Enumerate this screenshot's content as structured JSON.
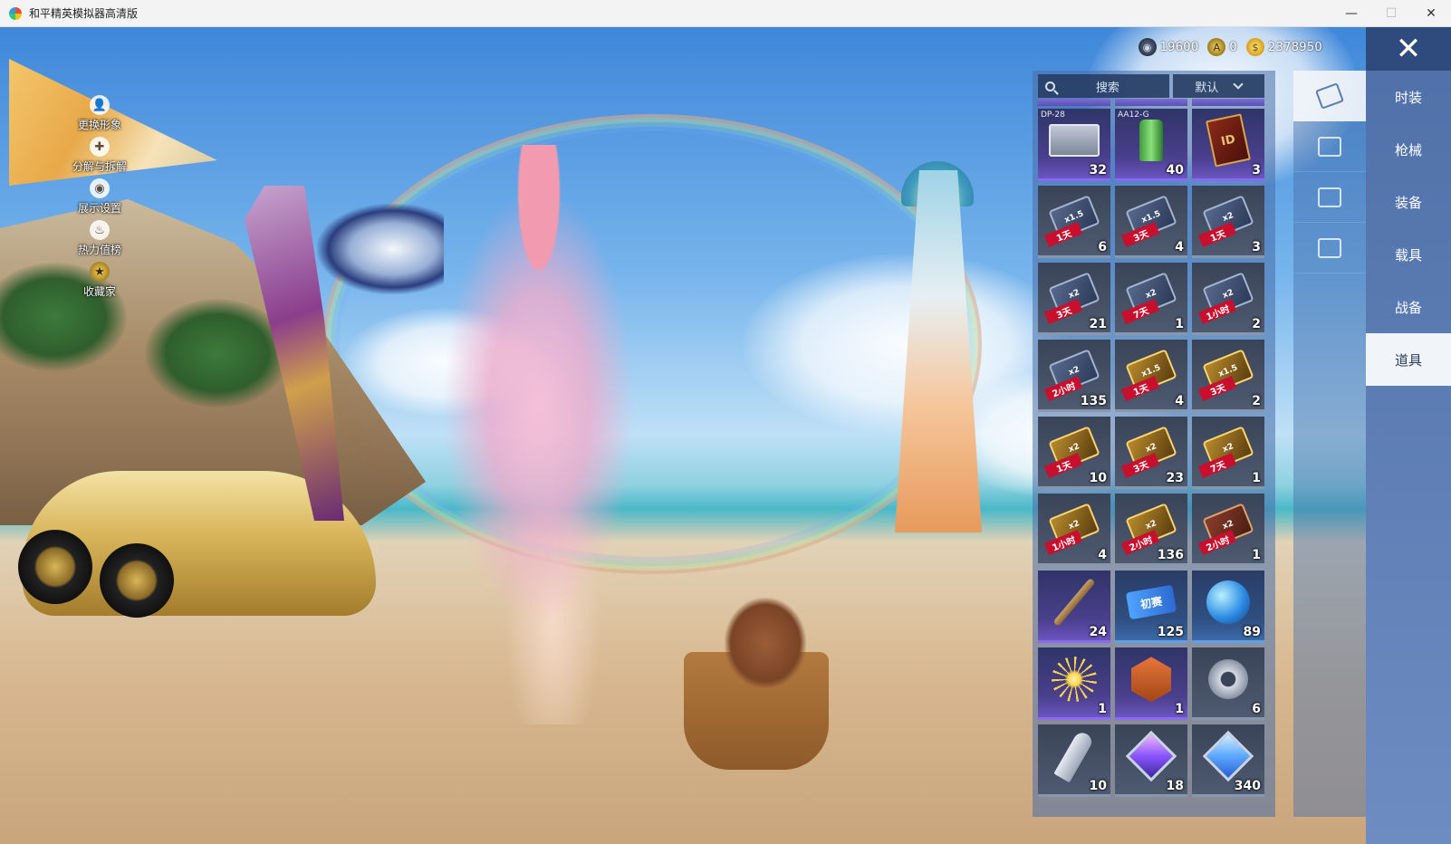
{
  "window": {
    "title": "和平精英模拟器高清版",
    "controls": {
      "minimize": "—",
      "maximize": "☐",
      "close": "✕"
    }
  },
  "left_menu": [
    {
      "label": "更换形象",
      "icon": "person-icon",
      "glyph": "👤"
    },
    {
      "label": "分解与拆解",
      "icon": "puzzle-icon",
      "glyph": "✚"
    },
    {
      "label": "展示设置",
      "icon": "eye-icon",
      "glyph": "◉"
    },
    {
      "label": "热力值榜",
      "icon": "flame-icon",
      "glyph": "♨"
    },
    {
      "label": "收藏家",
      "icon": "collector-badge-icon",
      "glyph": "★"
    }
  ],
  "currency": [
    {
      "icon": "points-coin-icon",
      "glyph": "◉",
      "value": "19600"
    },
    {
      "icon": "a-coin-icon",
      "glyph": "A",
      "value": "0"
    },
    {
      "icon": "gold-coin-icon",
      "glyph": "$",
      "value": "2378950"
    }
  ],
  "inventory": {
    "search_placeholder": "搜索",
    "sort_label": "默认",
    "items": [
      {
        "name": "DP-28",
        "count": "32",
        "rarity": "purple",
        "icon": "weapon-box-icon"
      },
      {
        "name": "AA12-G",
        "count": "40",
        "rarity": "purple",
        "icon": "spray-can-icon"
      },
      {
        "name": "",
        "count": "3",
        "rarity": "purple",
        "icon": "id-card-book-icon",
        "glyph": "ID"
      },
      {
        "name": "",
        "count": "6",
        "rarity": "gray",
        "icon": "exp-card-icon",
        "mult": "x1.5",
        "duration": "1天",
        "style": ""
      },
      {
        "name": "",
        "count": "4",
        "rarity": "gray",
        "icon": "exp-card-icon",
        "mult": "x1.5",
        "duration": "3天",
        "style": ""
      },
      {
        "name": "",
        "count": "3",
        "rarity": "gray",
        "icon": "exp-card-icon",
        "mult": "x2",
        "duration": "1天",
        "style": ""
      },
      {
        "name": "",
        "count": "21",
        "rarity": "gray",
        "icon": "exp-card-icon",
        "mult": "x2",
        "duration": "3天",
        "style": ""
      },
      {
        "name": "",
        "count": "1",
        "rarity": "gray",
        "icon": "exp-card-icon",
        "mult": "x2",
        "duration": "7天",
        "style": ""
      },
      {
        "name": "",
        "count": "2",
        "rarity": "gray",
        "icon": "exp-card-icon",
        "mult": "x2",
        "duration": "1小时",
        "style": ""
      },
      {
        "name": "",
        "count": "135",
        "rarity": "gray",
        "icon": "exp-card-icon",
        "mult": "x2",
        "duration": "2小时",
        "style": ""
      },
      {
        "name": "",
        "count": "4",
        "rarity": "gray",
        "icon": "coin-card-icon",
        "mult": "x1.5",
        "duration": "1天",
        "style": "gold"
      },
      {
        "name": "",
        "count": "2",
        "rarity": "gray",
        "icon": "coin-card-icon",
        "mult": "x1.5",
        "duration": "3天",
        "style": "gold"
      },
      {
        "name": "",
        "count": "10",
        "rarity": "gray",
        "icon": "coin-card-icon",
        "mult": "x2",
        "duration": "1天",
        "style": "gold"
      },
      {
        "name": "",
        "count": "23",
        "rarity": "gray",
        "icon": "coin-card-icon",
        "mult": "x2",
        "duration": "3天",
        "style": "gold"
      },
      {
        "name": "",
        "count": "1",
        "rarity": "gray",
        "icon": "coin-card-icon",
        "mult": "x2",
        "duration": "7天",
        "style": "gold"
      },
      {
        "name": "",
        "count": "4",
        "rarity": "gray",
        "icon": "coin-card-icon",
        "mult": "x2",
        "duration": "1小时",
        "style": "gold"
      },
      {
        "name": "",
        "count": "136",
        "rarity": "gray",
        "icon": "coin-card-icon",
        "mult": "x2",
        "duration": "2小时",
        "style": "gold"
      },
      {
        "name": "",
        "count": "1",
        "rarity": "gray",
        "icon": "team-card-icon",
        "mult": "x2",
        "duration": "2小时",
        "style": "red"
      },
      {
        "name": "",
        "count": "24",
        "rarity": "purple",
        "icon": "stick-icon"
      },
      {
        "name": "",
        "count": "125",
        "rarity": "blue",
        "icon": "ticket-icon",
        "glyph": "初赛"
      },
      {
        "name": "",
        "count": "89",
        "rarity": "blue",
        "icon": "puzzle-orb-icon"
      },
      {
        "name": "",
        "count": "1",
        "rarity": "purple",
        "icon": "firework-icon"
      },
      {
        "name": "",
        "count": "1",
        "rarity": "purple",
        "icon": "medal-badge-icon"
      },
      {
        "name": "",
        "count": "6",
        "rarity": "gray",
        "icon": "gear-part-icon"
      },
      {
        "name": "",
        "count": "10",
        "rarity": "gray",
        "icon": "key-icon"
      },
      {
        "name": "",
        "count": "18",
        "rarity": "gray",
        "icon": "gem-frame-icon"
      },
      {
        "name": "",
        "count": "340",
        "rarity": "gray",
        "icon": "diamond-icon"
      }
    ]
  },
  "icon_nav": [
    {
      "icon": "cards-icon",
      "active": true
    },
    {
      "icon": "chest-icon",
      "active": false
    },
    {
      "icon": "sparkle-icon",
      "active": false
    },
    {
      "icon": "voucher-icon",
      "active": false
    }
  ],
  "categories": {
    "close": "✕",
    "tabs": [
      {
        "label": "时装",
        "active": false
      },
      {
        "label": "枪械",
        "active": false
      },
      {
        "label": "装备",
        "active": false
      },
      {
        "label": "载具",
        "active": false
      },
      {
        "label": "战备",
        "active": false
      },
      {
        "label": "道具",
        "active": true
      }
    ]
  }
}
